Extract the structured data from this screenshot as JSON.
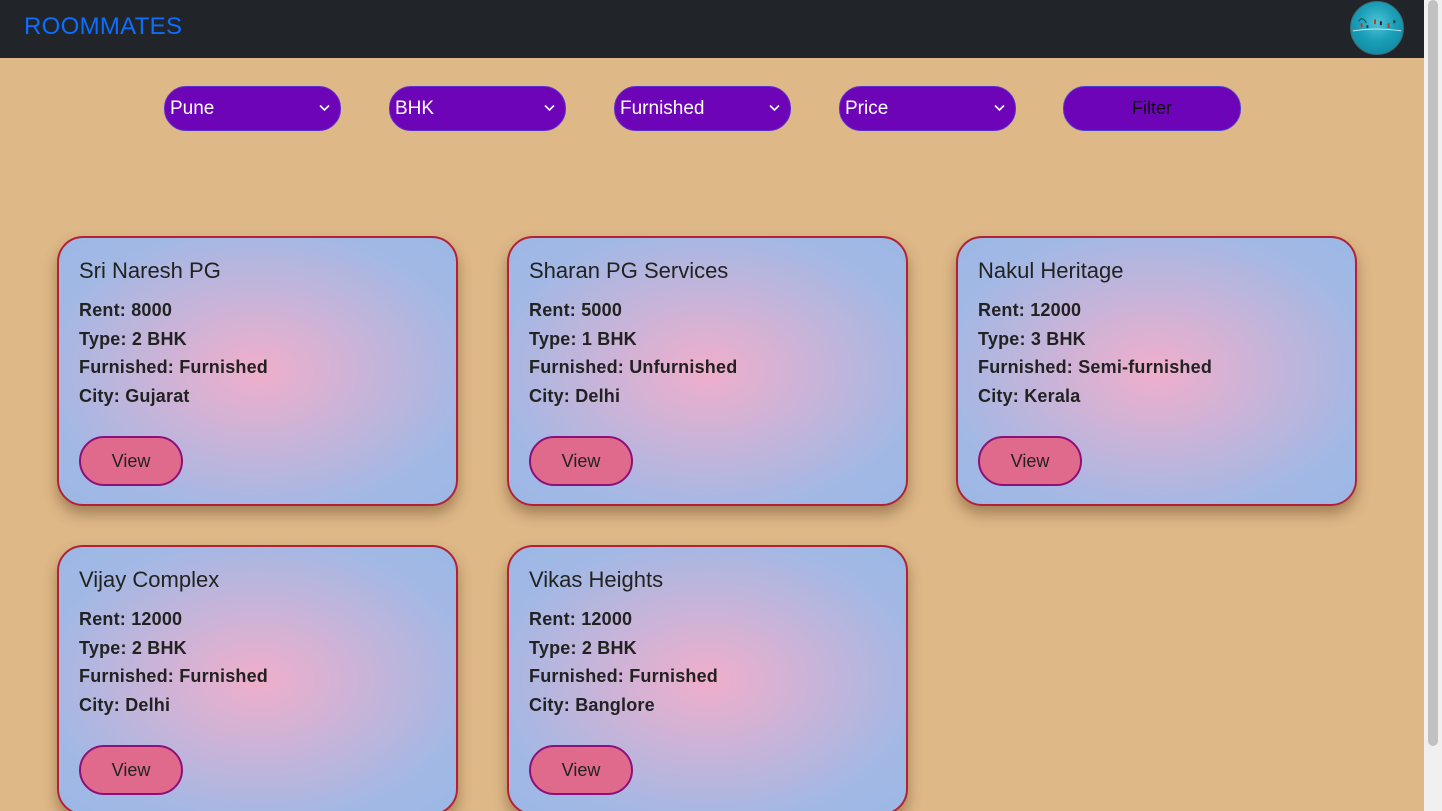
{
  "navbar": {
    "brand": "ROOMMATES",
    "avatar_icon": "profile-avatar-icon"
  },
  "filters": {
    "city": "Pune",
    "bhk": "BHK",
    "furnished": "Furnished",
    "price": "Price",
    "filter_button": "Filter"
  },
  "cards": [
    {
      "name": "Sri Naresh PG",
      "rent": "Rent: 8000",
      "type": "Type: 2 BHK",
      "furnished": "Furnished: Furnished",
      "city": "City: Gujarat",
      "view": "View"
    },
    {
      "name": "Sharan PG Services",
      "rent": "Rent: 5000",
      "type": "Type: 1 BHK",
      "furnished": "Furnished: Unfurnished",
      "city": "City: Delhi",
      "view": "View"
    },
    {
      "name": "Nakul Heritage",
      "rent": "Rent: 12000",
      "type": "Type: 3 BHK",
      "furnished": "Furnished: Semi-furnished",
      "city": "City: Kerala",
      "view": "View"
    },
    {
      "name": "Vijay Complex",
      "rent": "Rent: 12000",
      "type": "Type: 2 BHK",
      "furnished": "Furnished: Furnished",
      "city": "City: Delhi",
      "view": "View"
    },
    {
      "name": "Vikas Heights",
      "rent": "Rent: 12000",
      "type": "Type: 2 BHK",
      "furnished": "Furnished: Furnished",
      "city": "City: Banglore",
      "view": "View"
    }
  ],
  "colors": {
    "page_bg": "#deb887",
    "navbar_bg": "#212529",
    "brand": "#0d6efd",
    "select_bg": "#6e04b8",
    "card_border": "#b22234",
    "view_button": "#e06a8c"
  }
}
